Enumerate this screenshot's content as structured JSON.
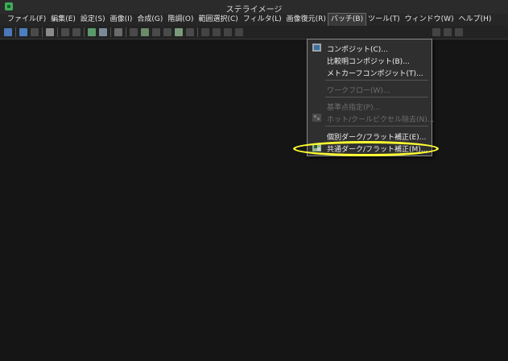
{
  "window": {
    "title": "ステライメージ"
  },
  "menubar": {
    "items": [
      {
        "label": "ファイル(F)"
      },
      {
        "label": "編集(E)"
      },
      {
        "label": "設定(S)"
      },
      {
        "label": "画像(I)"
      },
      {
        "label": "合成(G)"
      },
      {
        "label": "階調(O)"
      },
      {
        "label": "範囲選択(C)"
      },
      {
        "label": "フィルタ(L)"
      },
      {
        "label": "画像復元(R)"
      },
      {
        "label": "バッチ(B)"
      },
      {
        "label": "ツール(T)"
      },
      {
        "label": "ウィンドウ(W)"
      },
      {
        "label": "ヘルプ(H)"
      }
    ]
  },
  "batch_menu": {
    "items": [
      {
        "label": "コンポジット(C)...",
        "enabled": true
      },
      {
        "label": "比較明コンポジット(B)...",
        "enabled": true
      },
      {
        "label": "メトカーフコンポジット(T)...",
        "enabled": true
      },
      {
        "label": "ワークフロー(W)...",
        "enabled": false
      },
      {
        "label": "基準点指定(P)...",
        "enabled": false
      },
      {
        "label": "ホット/クールピクセル除去(N)...",
        "enabled": false
      },
      {
        "label": "個別ダーク/フラット補正(E)...",
        "enabled": true
      },
      {
        "label": "共通ダーク/フラット補正(M)...",
        "enabled": true
      }
    ]
  },
  "colors": {
    "highlight": "#ffff33",
    "accent_green": "#3fae5a"
  }
}
